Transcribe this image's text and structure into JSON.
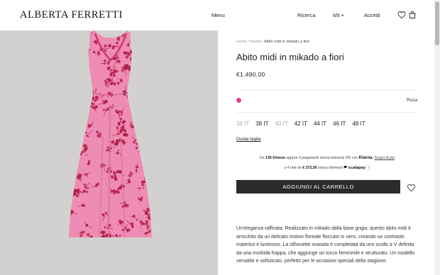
{
  "header": {
    "logo": "ALBERTA FERRETTI",
    "menu": "Menu",
    "search": "Ricerca",
    "language": "it/it +",
    "login": "Accedi",
    "icons": [
      "heart-icon",
      "bag-icon"
    ]
  },
  "breadcrumb": {
    "home": "Home",
    "sep1": "/",
    "section": "Novità",
    "sep2": "/",
    "current": "Abito midi in mikado a fiori"
  },
  "product": {
    "title": "Abito midi in mikado a fiori",
    "price": "€1.490,00",
    "color": {
      "name": "Rosa",
      "swatch": "#e0438f"
    },
    "sizes": [
      {
        "label": "36 IT",
        "available": false
      },
      {
        "label": "38 IT",
        "available": true
      },
      {
        "label": "40 IT",
        "available": false
      },
      {
        "label": "42 IT",
        "available": true
      },
      {
        "label": "44 IT",
        "available": true
      },
      {
        "label": "46 IT",
        "available": true
      },
      {
        "label": "48 IT",
        "available": true
      }
    ],
    "size_guide": "Guida taglie",
    "klarna": {
      "prefix": "Da",
      "amount": "135 €/mese",
      "text": "oppure 3 pagamenti senza interessi 0% con",
      "brand": "Klarna.",
      "link": "Scopri di più"
    },
    "scalapay": {
      "prefix": "o 4 rate da",
      "amount": "€ 372,50",
      "text": "senza interessi",
      "brand": "❤ scalapay",
      "info": "ⓘ"
    },
    "add_to_cart": "AGGIUNGI AL CARRELLO",
    "description": "Un'eleganza raffinata. Realizzato in mikado dalla base grigia, questo abito midi è arricchito da un delicato motivo floreale floccato in nero, creando un contrasto materico e luminoso. La silhouette svasata è completata da uno scollo a V definito da una morbida frappa, che aggiunge un tocco femminile e strutturato. Un modello versatile e sofisticato, perfetto per le occasioni speciali della stagione."
  },
  "colors": {
    "background_photo": "#d3d1cf",
    "dress_pink": "#ee8cb4",
    "flower_red": "#b01e48",
    "button": "#2b2b2b"
  }
}
